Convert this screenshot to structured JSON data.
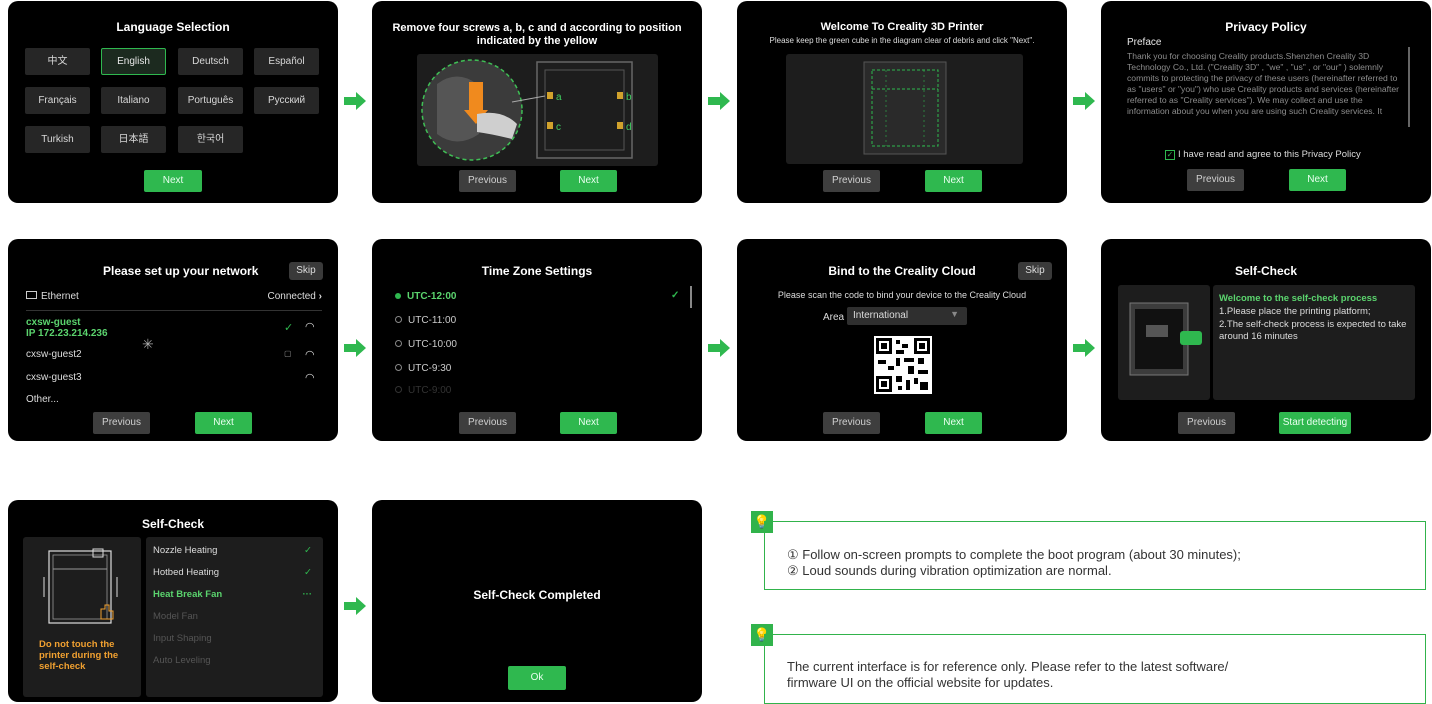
{
  "colors": {
    "accent": "#2fb84f",
    "warning": "#f0a030"
  },
  "screen1": {
    "title": "Language Selection",
    "languages": [
      "中文",
      "English",
      "Deutsch",
      "Español",
      "Français",
      "Italiano",
      "Português",
      "Русский",
      "Turkish",
      "日本語",
      "한국어"
    ],
    "selected": "English",
    "next": "Next"
  },
  "screen2": {
    "title_line1": "Remove four screws a, b, c and d according to position",
    "title_line2": "indicated by the yellow",
    "labels": [
      "a",
      "b",
      "c",
      "d"
    ],
    "previous": "Previous",
    "next": "Next"
  },
  "screen3": {
    "title": "Welcome To Creality 3D Printer",
    "subtitle": "Please keep the green cube in the diagram clear of debris and click \"Next\".",
    "previous": "Previous",
    "next": "Next"
  },
  "screen4": {
    "title": "Privacy Policy",
    "heading": "Preface",
    "body": "Thank you for choosing Creality products.Shenzhen Creality 3D Technology Co., Ltd. (\"Creality 3D\" , \"we\" , \"us\" , or \"our\" ) solemnly commits to protecting the privacy of these users (hereinafter referred to as \"users\" or \"you\") who use Creality products and services (hereinafter referred to as \"Creality services\"). We may collect and use the information about you when you are using such Creality services. It",
    "agree": "I have read and agree to this Privacy Policy",
    "previous": "Previous",
    "next": "Next"
  },
  "screen5": {
    "title": "Please set up your network",
    "skip": "Skip",
    "ethernet": "Ethernet",
    "connected": "Connected",
    "networks": [
      {
        "name": "cxsw-guest",
        "ip": "IP 172.23.214.236"
      },
      {
        "name": "cxsw-guest2"
      },
      {
        "name": "cxsw-guest3"
      },
      {
        "name": "Other..."
      }
    ],
    "previous": "Previous",
    "next": "Next"
  },
  "screen6": {
    "title": "Time Zone Settings",
    "zones": [
      "UTC-12:00",
      "UTC-11:00",
      "UTC-10:00",
      "UTC-9:30",
      "UTC-9:00"
    ],
    "selected": "UTC-12:00",
    "previous": "Previous",
    "next": "Next"
  },
  "screen7": {
    "title": "Bind to the Creality Cloud",
    "skip": "Skip",
    "instruction": "Please scan the code to bind your device to the Creality Cloud",
    "area_label": "Area",
    "area_value": "International",
    "previous": "Previous",
    "next": "Next"
  },
  "screen8": {
    "title": "Self-Check",
    "welcome": "Welcome to the self-check process",
    "line1": "1.Please place the printing platform;",
    "line2": "2.The self-check process is expected to take around 16 minutes",
    "previous": "Previous",
    "start": "Start detecting"
  },
  "screen9": {
    "title": "Self-Check",
    "warning": "Do not touch the printer during the self-check",
    "items": [
      {
        "label": "Nozzle Heating",
        "state": "done"
      },
      {
        "label": "Hotbed Heating",
        "state": "done"
      },
      {
        "label": "Heat Break Fan",
        "state": "active"
      },
      {
        "label": "Model Fan",
        "state": "pending"
      },
      {
        "label": "Input Shaping",
        "state": "pending"
      },
      {
        "label": "Auto Leveling",
        "state": "pending"
      }
    ]
  },
  "screen10": {
    "title": "Self-Check Completed",
    "ok": "Ok"
  },
  "tips": {
    "tip1_line1": "① Follow on-screen prompts to complete the boot program (about 30 minutes);",
    "tip1_line2": "② Loud sounds during vibration optimization are normal.",
    "tip2_line1": "The current interface is for reference only. Please refer to the latest software/",
    "tip2_line2": "firmware UI on the official website for updates."
  }
}
